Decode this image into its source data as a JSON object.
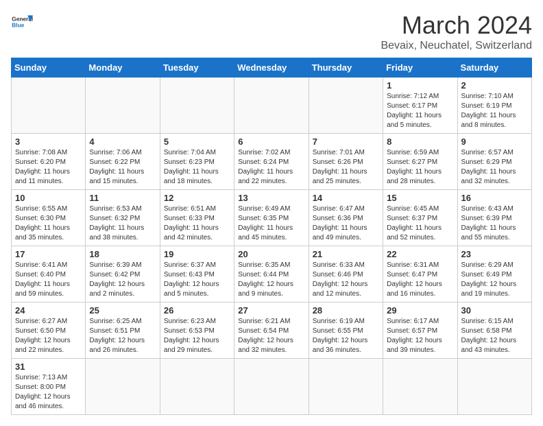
{
  "header": {
    "logo_text_general": "General",
    "logo_text_blue": "Blue",
    "title": "March 2024",
    "subtitle": "Bevaix, Neuchatel, Switzerland"
  },
  "weekdays": [
    "Sunday",
    "Monday",
    "Tuesday",
    "Wednesday",
    "Thursday",
    "Friday",
    "Saturday"
  ],
  "weeks": [
    [
      {
        "day": "",
        "info": ""
      },
      {
        "day": "",
        "info": ""
      },
      {
        "day": "",
        "info": ""
      },
      {
        "day": "",
        "info": ""
      },
      {
        "day": "",
        "info": ""
      },
      {
        "day": "1",
        "info": "Sunrise: 7:12 AM\nSunset: 6:17 PM\nDaylight: 11 hours and 5 minutes."
      },
      {
        "day": "2",
        "info": "Sunrise: 7:10 AM\nSunset: 6:19 PM\nDaylight: 11 hours and 8 minutes."
      }
    ],
    [
      {
        "day": "3",
        "info": "Sunrise: 7:08 AM\nSunset: 6:20 PM\nDaylight: 11 hours and 11 minutes."
      },
      {
        "day": "4",
        "info": "Sunrise: 7:06 AM\nSunset: 6:22 PM\nDaylight: 11 hours and 15 minutes."
      },
      {
        "day": "5",
        "info": "Sunrise: 7:04 AM\nSunset: 6:23 PM\nDaylight: 11 hours and 18 minutes."
      },
      {
        "day": "6",
        "info": "Sunrise: 7:02 AM\nSunset: 6:24 PM\nDaylight: 11 hours and 22 minutes."
      },
      {
        "day": "7",
        "info": "Sunrise: 7:01 AM\nSunset: 6:26 PM\nDaylight: 11 hours and 25 minutes."
      },
      {
        "day": "8",
        "info": "Sunrise: 6:59 AM\nSunset: 6:27 PM\nDaylight: 11 hours and 28 minutes."
      },
      {
        "day": "9",
        "info": "Sunrise: 6:57 AM\nSunset: 6:29 PM\nDaylight: 11 hours and 32 minutes."
      }
    ],
    [
      {
        "day": "10",
        "info": "Sunrise: 6:55 AM\nSunset: 6:30 PM\nDaylight: 11 hours and 35 minutes."
      },
      {
        "day": "11",
        "info": "Sunrise: 6:53 AM\nSunset: 6:32 PM\nDaylight: 11 hours and 38 minutes."
      },
      {
        "day": "12",
        "info": "Sunrise: 6:51 AM\nSunset: 6:33 PM\nDaylight: 11 hours and 42 minutes."
      },
      {
        "day": "13",
        "info": "Sunrise: 6:49 AM\nSunset: 6:35 PM\nDaylight: 11 hours and 45 minutes."
      },
      {
        "day": "14",
        "info": "Sunrise: 6:47 AM\nSunset: 6:36 PM\nDaylight: 11 hours and 49 minutes."
      },
      {
        "day": "15",
        "info": "Sunrise: 6:45 AM\nSunset: 6:37 PM\nDaylight: 11 hours and 52 minutes."
      },
      {
        "day": "16",
        "info": "Sunrise: 6:43 AM\nSunset: 6:39 PM\nDaylight: 11 hours and 55 minutes."
      }
    ],
    [
      {
        "day": "17",
        "info": "Sunrise: 6:41 AM\nSunset: 6:40 PM\nDaylight: 11 hours and 59 minutes."
      },
      {
        "day": "18",
        "info": "Sunrise: 6:39 AM\nSunset: 6:42 PM\nDaylight: 12 hours and 2 minutes."
      },
      {
        "day": "19",
        "info": "Sunrise: 6:37 AM\nSunset: 6:43 PM\nDaylight: 12 hours and 5 minutes."
      },
      {
        "day": "20",
        "info": "Sunrise: 6:35 AM\nSunset: 6:44 PM\nDaylight: 12 hours and 9 minutes."
      },
      {
        "day": "21",
        "info": "Sunrise: 6:33 AM\nSunset: 6:46 PM\nDaylight: 12 hours and 12 minutes."
      },
      {
        "day": "22",
        "info": "Sunrise: 6:31 AM\nSunset: 6:47 PM\nDaylight: 12 hours and 16 minutes."
      },
      {
        "day": "23",
        "info": "Sunrise: 6:29 AM\nSunset: 6:49 PM\nDaylight: 12 hours and 19 minutes."
      }
    ],
    [
      {
        "day": "24",
        "info": "Sunrise: 6:27 AM\nSunset: 6:50 PM\nDaylight: 12 hours and 22 minutes."
      },
      {
        "day": "25",
        "info": "Sunrise: 6:25 AM\nSunset: 6:51 PM\nDaylight: 12 hours and 26 minutes."
      },
      {
        "day": "26",
        "info": "Sunrise: 6:23 AM\nSunset: 6:53 PM\nDaylight: 12 hours and 29 minutes."
      },
      {
        "day": "27",
        "info": "Sunrise: 6:21 AM\nSunset: 6:54 PM\nDaylight: 12 hours and 32 minutes."
      },
      {
        "day": "28",
        "info": "Sunrise: 6:19 AM\nSunset: 6:55 PM\nDaylight: 12 hours and 36 minutes."
      },
      {
        "day": "29",
        "info": "Sunrise: 6:17 AM\nSunset: 6:57 PM\nDaylight: 12 hours and 39 minutes."
      },
      {
        "day": "30",
        "info": "Sunrise: 6:15 AM\nSunset: 6:58 PM\nDaylight: 12 hours and 43 minutes."
      }
    ],
    [
      {
        "day": "31",
        "info": "Sunrise: 7:13 AM\nSunset: 8:00 PM\nDaylight: 12 hours and 46 minutes."
      },
      {
        "day": "",
        "info": ""
      },
      {
        "day": "",
        "info": ""
      },
      {
        "day": "",
        "info": ""
      },
      {
        "day": "",
        "info": ""
      },
      {
        "day": "",
        "info": ""
      },
      {
        "day": "",
        "info": ""
      }
    ]
  ]
}
